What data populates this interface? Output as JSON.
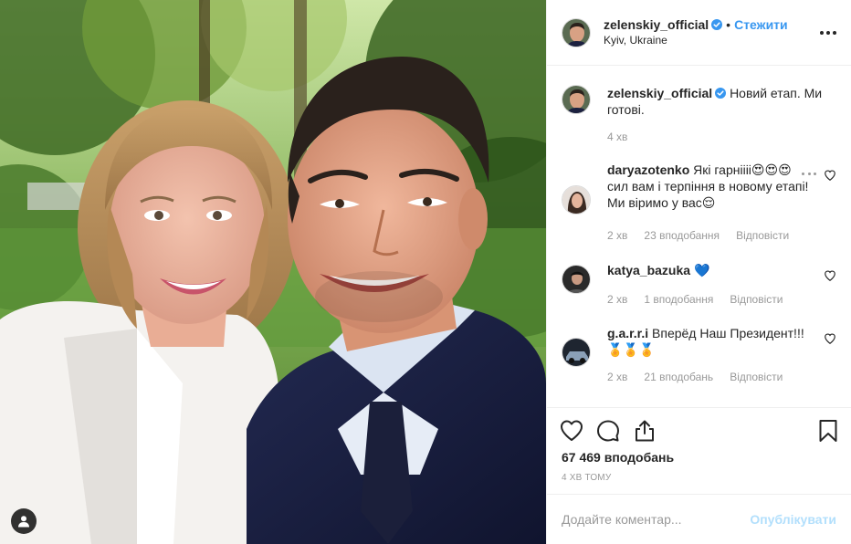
{
  "post": {
    "username": "zelenskiy_official",
    "follow_label": "Стежити",
    "dot": "•",
    "location": "Kyiv, Ukraine",
    "caption": "Новий етап. Ми готові.",
    "caption_time": "4 хв",
    "likes_count": "67 469 вподобань",
    "timestamp": "4 ХВ ТОМУ"
  },
  "comments": [
    {
      "username": "daryazotenko",
      "text": "Які гарніііі😍😍😍 сил вам і терпіння в новому етапі! Ми віримо у вас😌",
      "time": "2 хв",
      "likes": "23 вподобання",
      "reply": "Відповісти"
    },
    {
      "username": "katya_bazuka",
      "text": "💙",
      "time": "2 хв",
      "likes": "1 вподобання",
      "reply": "Відповісти"
    },
    {
      "username": "g.a.r.r.i",
      "text": "Вперёд Наш Президент!!! 🏅🏅🏅",
      "time": "2 хв",
      "likes": "21 вподобань",
      "reply": "Відповісти"
    }
  ],
  "composer": {
    "placeholder": "Додайте коментар...",
    "post_label": "Опублікувати"
  },
  "colors": {
    "link_blue": "#3897f0",
    "verified_blue": "#3897f0",
    "muted": "#999999",
    "post_button_disabled": "#b2dffc"
  },
  "icons": [
    "user-tag-icon",
    "verified-icon",
    "more-options-icon",
    "heart-icon",
    "comment-icon",
    "share-icon",
    "bookmark-icon"
  ]
}
